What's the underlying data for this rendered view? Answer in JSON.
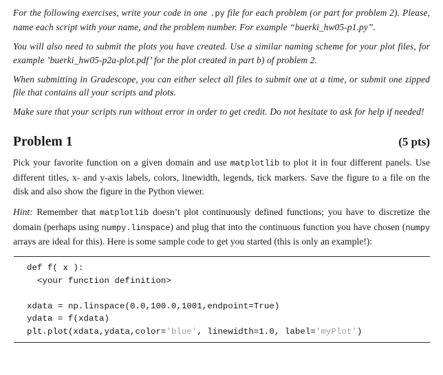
{
  "document": {
    "intro_paragraphs": [
      {
        "id": "para-naming",
        "segments": [
          {
            "type": "text",
            "value": "For the following exercises, write your code in one "
          },
          {
            "type": "code",
            "value": ".py"
          },
          {
            "type": "text",
            "value": " file for each problem (or part for problem 2). Please, name each script with your name, and the problem number. For example “buerki_hw05-p1.py”."
          }
        ]
      },
      {
        "id": "para-plots",
        "segments": [
          {
            "type": "text",
            "value": "You will also need to submit the plots you have created. Use a similar naming scheme for your plot files, for example ’buerki_hw05-p2a-plot.pdf’ for the plot created in part b) of problem 2."
          }
        ]
      },
      {
        "id": "para-gradescope",
        "segments": [
          {
            "type": "text",
            "value": "When submitting in Gradescope, you can either select all files to submit one at a time, or submit one zipped file that contains all your scripts and plots."
          }
        ]
      },
      {
        "id": "para-errors",
        "segments": [
          {
            "type": "text",
            "value": "Make sure that your scripts run without error in order to get credit. Do not hesitate to ask for help if needed!"
          }
        ]
      }
    ],
    "section": {
      "title": "Problem 1",
      "points": "(5 pts)"
    },
    "body_paragraph": {
      "segments": [
        {
          "type": "text",
          "value": "Pick your favorite function on a given domain and use "
        },
        {
          "type": "code",
          "value": "matplotlib"
        },
        {
          "type": "text",
          "value": " to plot it in four different panels. Use different titles, x- and y-axis labels, colors, linewidth, legends, tick markers. Save the figure to a file on the disk and also show the figure in the Python viewer."
        }
      ]
    },
    "hint_paragraph": {
      "label": "Hint:",
      "segments": [
        {
          "type": "text",
          "value": " Remember that "
        },
        {
          "type": "code",
          "value": "matplotlib"
        },
        {
          "type": "text",
          "value": " doesn’t plot continuously defined functions; you have to discretize the domain (perhaps using "
        },
        {
          "type": "code",
          "value": "numpy.linspace"
        },
        {
          "type": "text",
          "value": ") and plug that into the continuous function you have chosen ("
        },
        {
          "type": "code",
          "value": "numpy"
        },
        {
          "type": "text",
          "value": " arrays are ideal for this). Here is some sample code to get you started (this is only an example!):"
        }
      ]
    },
    "code_listing": {
      "lines": [
        [
          {
            "type": "plain",
            "value": "def f( x ):"
          }
        ],
        [
          {
            "type": "plain",
            "value": "  <your function definition>"
          }
        ],
        [
          {
            "type": "plain",
            "value": ""
          }
        ],
        [
          {
            "type": "plain",
            "value": "xdata = np.linspace(0.0,100.0,1001,endpoint=True)"
          }
        ],
        [
          {
            "type": "plain",
            "value": "ydata = f(xdata)"
          }
        ],
        [
          {
            "type": "plain",
            "value": "plt.plot(xdata,ydata,color="
          },
          {
            "type": "string",
            "value": "'blue'"
          },
          {
            "type": "plain",
            "value": ", linewidth=1.0, label="
          },
          {
            "type": "string",
            "value": "'myPlot'"
          },
          {
            "type": "plain",
            "value": ")"
          }
        ]
      ],
      "string_color": "#9a9aa2",
      "rule_color": "#2b2b2b"
    }
  }
}
